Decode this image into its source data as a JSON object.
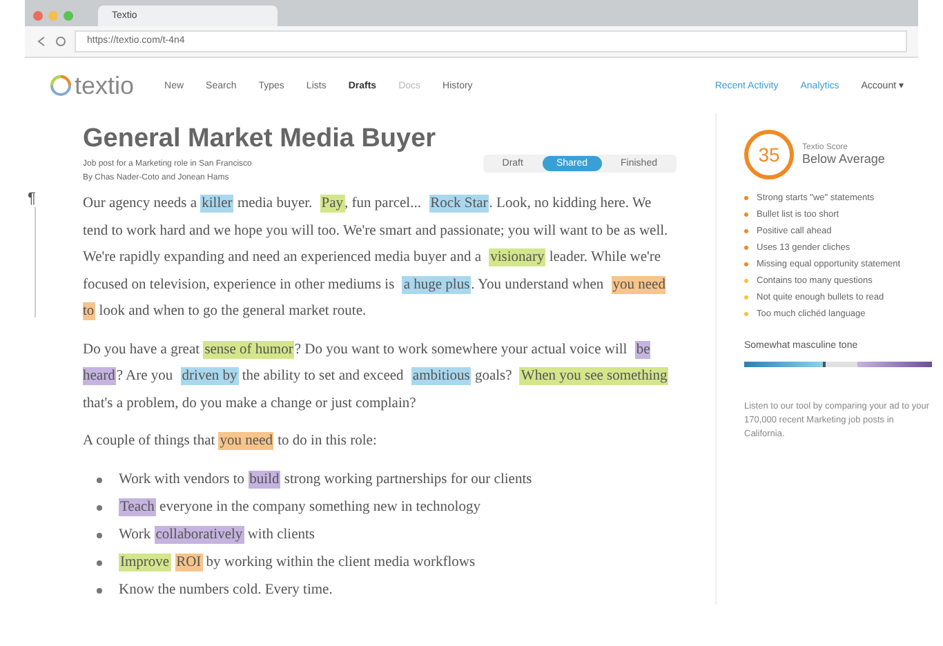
{
  "browser": {
    "tab_title": "Textio",
    "url": "https://textio.com/t-4n4"
  },
  "nav": {
    "logo": "textio",
    "items": [
      {
        "label": "New",
        "selected": false,
        "disabled": false
      },
      {
        "label": "Search",
        "selected": false,
        "disabled": false
      },
      {
        "label": "Types",
        "selected": false,
        "disabled": false
      },
      {
        "label": "Lists",
        "selected": false,
        "disabled": false
      },
      {
        "label": "Drafts",
        "selected": true,
        "disabled": false
      },
      {
        "label": "Docs",
        "selected": false,
        "disabled": true
      },
      {
        "label": "History",
        "selected": false,
        "disabled": false
      }
    ],
    "links": [
      "Recent Activity",
      "Analytics"
    ],
    "account": "Account ▾"
  },
  "document": {
    "title": "General Market Media Buyer",
    "subtitle": "Job post for a Marketing role in San Francisco",
    "byline": "By Chas Nader-Coto and Jonean Hams",
    "status": [
      {
        "label": "Draft",
        "selected": false
      },
      {
        "label": "Shared",
        "selected": true
      },
      {
        "label": "Finished",
        "selected": false
      }
    ],
    "pilcrow": "¶",
    "blocks": [
      {
        "kind": "paragraph",
        "segments": [
          {
            "text": "Our agency needs a "
          },
          {
            "text": "killer",
            "color": "#a9d8ee"
          },
          {
            "text": " media buyer. "
          },
          {
            "text": "Pay",
            "color": "#d4e68a"
          },
          {
            "text": ", fun parcel... "
          },
          {
            "text": "Rock Star",
            "color": "#a9d8ee"
          },
          {
            "text": ". Look, no kidding here. We tend to work hard and we hope you will too. We're smart and passionate; you will want to be as well. We're rapidly expanding and need an experienced media buyer and a "
          },
          {
            "text": "visionary",
            "color": "#d4e68a"
          },
          {
            "text": " leader. While we're focused on television, experience in other mediums is "
          },
          {
            "text": "a huge plus",
            "color": "#a9d8ee"
          },
          {
            "text": ". You understand when "
          },
          {
            "text": "you need to",
            "color": "#f7c48a"
          },
          {
            "text": " look and when to go the general market route."
          }
        ]
      },
      {
        "kind": "paragraph",
        "segments": [
          {
            "text": "Do you have a great "
          },
          {
            "text": "sense of humor",
            "color": "#d4e68a"
          },
          {
            "text": "? Do you want to work somewhere your actual voice will "
          },
          {
            "text": "be heard",
            "color": "#c5b3e0"
          },
          {
            "text": "? Are you "
          },
          {
            "text": "driven by",
            "color": "#a9d8ee"
          },
          {
            "text": " the ability to set and exceed "
          },
          {
            "text": "ambitious",
            "color": "#a9d8ee"
          },
          {
            "text": " goals? "
          },
          {
            "text": "When you see something",
            "color": "#d4e68a"
          },
          {
            "text": " that's a problem, do you make a change or just complain?"
          }
        ]
      },
      {
        "kind": "paragraph",
        "segments": [
          {
            "text": "A couple of things that "
          },
          {
            "text": "you need",
            "color": "#f7c48a"
          },
          {
            "text": " to do in this role:"
          }
        ]
      },
      {
        "kind": "bullet",
        "segments": [
          {
            "text": "Work with vendors to "
          },
          {
            "text": "build",
            "color": "#c5b3e0"
          },
          {
            "text": " strong working partnerships for our clients"
          }
        ]
      },
      {
        "kind": "bullet",
        "segments": [
          {
            "text": "Teach",
            "color": "#c5b3e0"
          },
          {
            "text": " everyone in the company something new in technology"
          }
        ]
      },
      {
        "kind": "bullet",
        "segments": [
          {
            "text": "Work "
          },
          {
            "text": "collaboratively",
            "color": "#c5b3e0"
          },
          {
            "text": " with clients"
          }
        ]
      },
      {
        "kind": "bullet",
        "segments": [
          {
            "text": "Improve",
            "color": "#d4e68a"
          },
          {
            "text": "ROI",
            "color": "#f7c48a"
          },
          {
            "text": " by working within the client media workflows"
          }
        ]
      },
      {
        "kind": "bullet",
        "segments": [
          {
            "text": "Know the numbers cold. Every time."
          }
        ]
      }
    ]
  },
  "sidebar": {
    "score": "35",
    "score_label": "Textio Score",
    "score_rating": "Below Average",
    "issues": [
      {
        "text": "Strong starts \"we\" statements",
        "color": "#f08a24"
      },
      {
        "text": "Bullet list is too short",
        "color": "#f08a24"
      },
      {
        "text": "Positive call ahead",
        "color": "#f08a24"
      },
      {
        "text": "Uses 13 gender cliches",
        "color": "#f08a24"
      },
      {
        "text": "Missing equal opportunity statement",
        "color": "#f08a24"
      },
      {
        "text": "Contains too many questions",
        "color": "#f5c342"
      },
      {
        "text": "Not quite enough bullets to read",
        "color": "#f5c342"
      },
      {
        "text": "Too much clichéd language",
        "color": "#f5c342"
      }
    ],
    "tone": {
      "label": "Somewhat masculine tone",
      "level": 0.42
    },
    "note": "Listen to our tool by comparing your ad to your 170,000 recent Marketing job posts in California."
  }
}
